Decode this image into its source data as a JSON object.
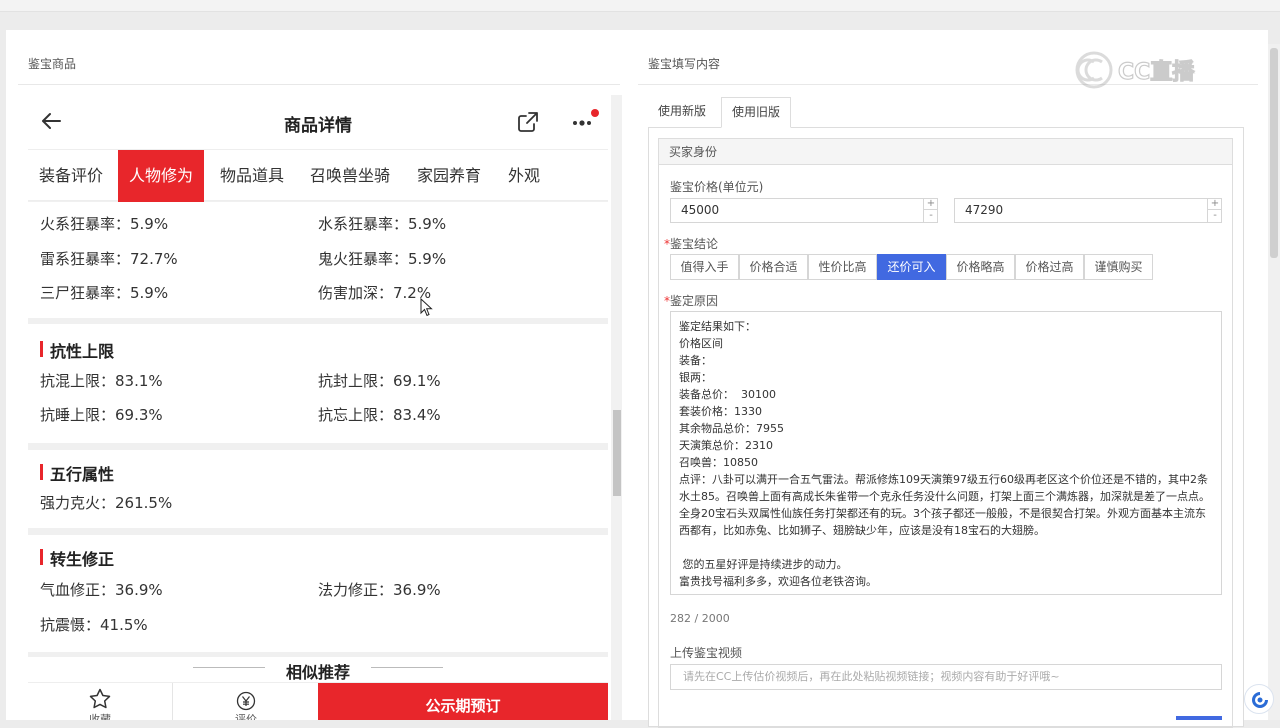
{
  "left_panel": {
    "title": "鉴宝商品"
  },
  "right_panel": {
    "title": "鉴宝填写内容"
  },
  "phone": {
    "title": "商品详情",
    "tabs": [
      {
        "label": "装备评价"
      },
      {
        "label": "人物修为"
      },
      {
        "label": "物品道具"
      },
      {
        "label": "召唤兽坐骑"
      },
      {
        "label": "家园养育"
      },
      {
        "label": "外观"
      }
    ],
    "active_tab_index": 1,
    "stats_top": [
      {
        "label": "火系狂暴率：5.9%"
      },
      {
        "label": "水系狂暴率：5.9%"
      },
      {
        "label": "雷系狂暴率：72.7%"
      },
      {
        "label": "鬼火狂暴率：5.9%"
      },
      {
        "label": "三尸狂暴率：5.9%"
      },
      {
        "label": "伤害加深：7.2%"
      }
    ],
    "sections": [
      {
        "title": "抗性上限",
        "items": [
          "抗混上限：83.1%",
          "抗封上限：69.1%",
          "抗睡上限：69.3%",
          "抗忘上限：83.4%"
        ]
      },
      {
        "title": "五行属性",
        "items": [
          "强力克火：261.5%"
        ]
      },
      {
        "title": "转生修正",
        "items": [
          "气血修正：36.9%",
          "法力修正：36.9%",
          "抗震慑：41.5%"
        ]
      }
    ],
    "similar_title": "相似推荐",
    "bottom": {
      "fav_label": "收藏",
      "eval_label": "评价",
      "reserve_label": "公示期预订"
    }
  },
  "form": {
    "version_tabs": [
      {
        "label": "使用新版"
      },
      {
        "label": "使用旧版"
      }
    ],
    "active_version_index": 1,
    "section_title": "买家身份",
    "price_label": "鉴宝价格(单位元)",
    "price_min": "45000",
    "price_max": "47290",
    "conclusion_label": "鉴宝结论",
    "conclusions": [
      {
        "label": "值得入手"
      },
      {
        "label": "价格合适"
      },
      {
        "label": "性价比高"
      },
      {
        "label": "还价可入"
      },
      {
        "label": "价格略高"
      },
      {
        "label": "价格过高"
      },
      {
        "label": "谨慎购买"
      }
    ],
    "active_conclusion_index": 3,
    "reason_label": "鉴定原因",
    "reason_lines": [
      "鉴定结果如下：",
      "价格区间",
      "装备：",
      "银两：",
      "装备总价：  30100",
      "套装价格：1330",
      "其余物品总价：7955",
      "天演策总价：2310",
      "召唤兽：10850",
      "点评：八卦可以满开一合五气雷法。帮派修炼109天演策97级五行60级再老区这个价位还是不错的，其中2条水土85。召唤兽上面有高成长朱雀带一个克永任务没什么问题，打架上面三个满炼器，加深就是差了一点点。全身20宝石头双属性仙族任务打架都还有的玩。3个孩子都还一般般，不是很契合打架。外观方面基本主流东西都有，比如赤兔、比如狮子、翅膀缺少年，应该是没有18宝石的大翅膀。",
      "",
      " 您的五星好评是持续进步的动力。",
      "富贵找号福利多多，欢迎各位老铁咨询。"
    ],
    "counter": "282 / 2000",
    "video_label": "上传鉴宝视频",
    "video_placeholder": "请先在CC上传估价视频后，再在此处粘贴视频链接；视频内容有助于好评哦~"
  },
  "watermark": "CC直播",
  "colors": {
    "accent_red": "#e8262b",
    "accent_blue": "#4169e1"
  }
}
